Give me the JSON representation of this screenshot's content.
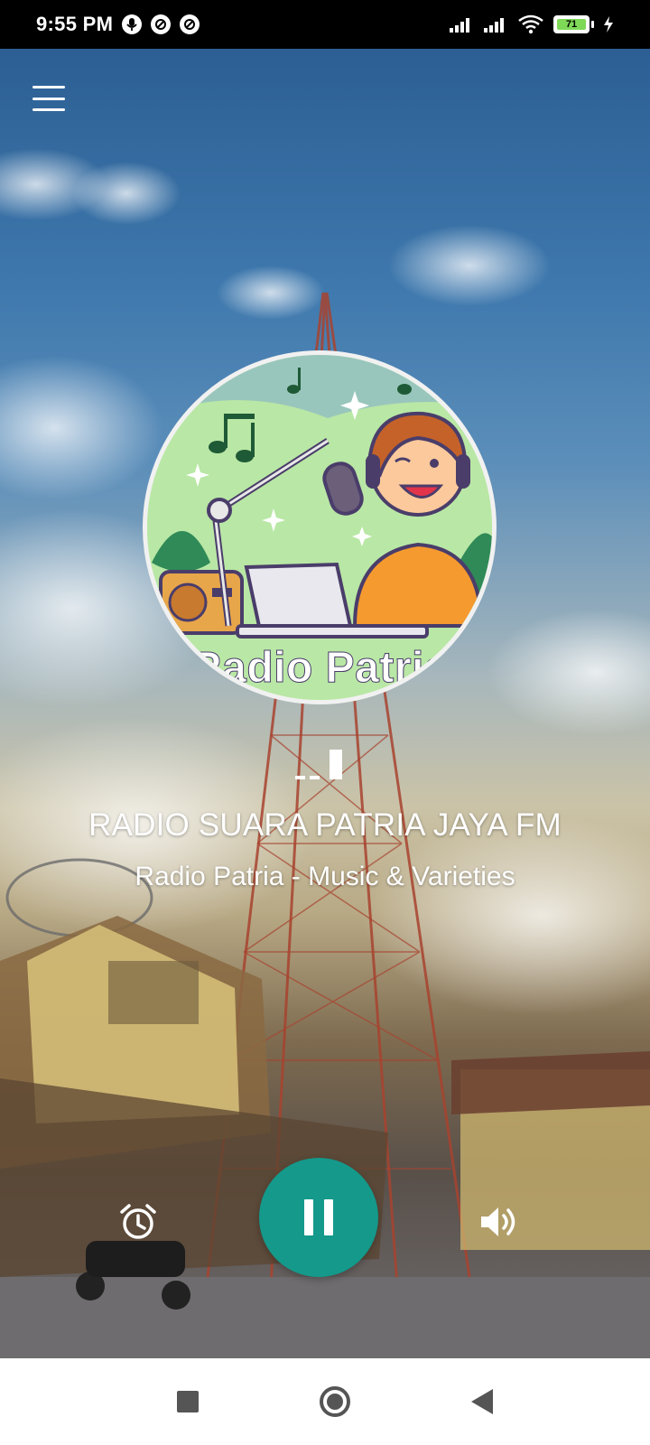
{
  "status_bar": {
    "time": "9:55 PM",
    "battery_level": "71",
    "icons": [
      "voice-search-icon",
      "vpn-icon",
      "vpn-icon",
      "signal-icon",
      "signal-icon",
      "wifi-icon",
      "battery-icon",
      "charging-icon"
    ]
  },
  "app": {
    "menu_icon": "hamburger-menu-icon",
    "logo": {
      "text": "Radio Patria",
      "colors": {
        "background": "#b9e7a5",
        "border": "#f1f1f1",
        "text": "#ffffff"
      }
    },
    "station": {
      "name": "RADIO SUARA PATRIA JAYA FM",
      "description": "Radio Patria - Music & Varieties"
    },
    "controls": {
      "alarm_icon": "alarm-clock-icon",
      "play_state": "playing",
      "play_pause_icon": "pause-icon",
      "volume_icon": "volume-icon"
    },
    "colors": {
      "accent": "#14998b",
      "text": "#ffffff"
    }
  },
  "nav_bar": {
    "icons": [
      "recent-apps-icon",
      "home-icon",
      "back-icon"
    ]
  }
}
